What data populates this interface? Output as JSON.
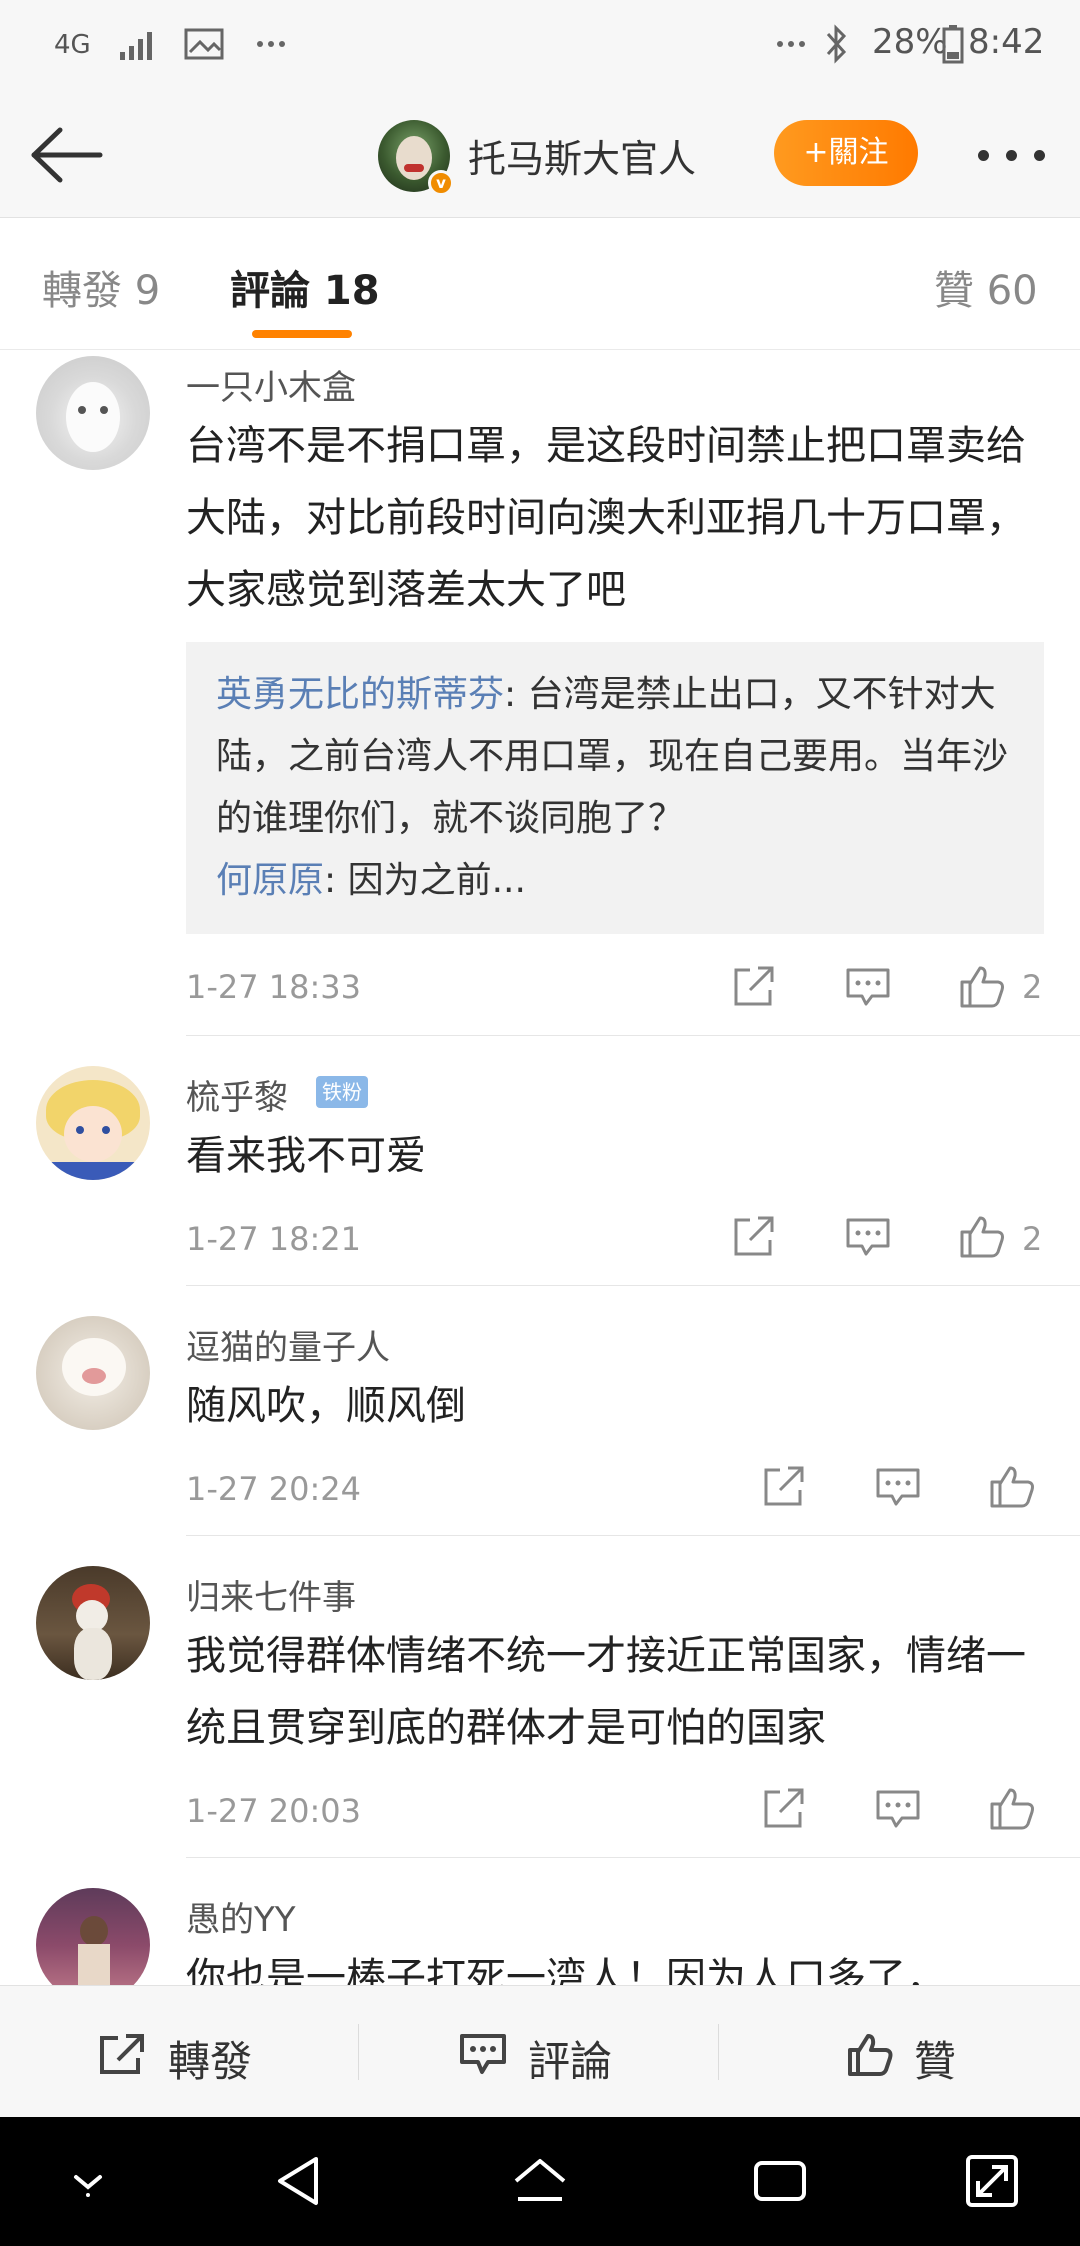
{
  "status_bar": {
    "network": "4G",
    "battery": "28%",
    "time": "8:42",
    "icons": [
      "signal-icon",
      "image-icon",
      "more-icon",
      "bluetooth-icon",
      "battery-icon"
    ]
  },
  "header": {
    "username": "托马斯大官人",
    "follow_label": "+關注"
  },
  "tabs": {
    "reposts": "轉發 9",
    "comments": "評論 18",
    "likes": "贊 60"
  },
  "comments": [
    {
      "name": "一只小木盒",
      "text": "台湾不是不捐口罩，是这段时间禁止把口罩卖给大陆，对比前段时间向澳大利亚捐几十万口罩，大家感觉到落差太大了吧",
      "replies": [
        {
          "user": "英勇无比的斯蒂芬",
          "sep": ": ",
          "text": "台湾是禁止出口，又不针对大陆，之前台湾人不用口罩，现在自己要用。当年沙的谁理你们，就不谈同胞了？"
        },
        {
          "user": "何原原",
          "sep": ":  ",
          "text": "因为之前..."
        }
      ],
      "time": "1-27 18:33",
      "likes": "2"
    },
    {
      "name": "梳乎黎",
      "badge": "铁粉",
      "text": "看来我不可爱",
      "time": "1-27 18:21",
      "likes": "2"
    },
    {
      "name": "逗猫的量子人",
      "text": "随风吹，顺风倒",
      "time": "1-27 20:24",
      "likes": ""
    },
    {
      "name": "归来七件事",
      "text": "我觉得群体情绪不统一才接近正常国家，情绪一统且贯穿到底的群体才是可怕的国家",
      "time": "1-27 20:03",
      "likes": ""
    },
    {
      "name": "愚的YY",
      "text": "你也是一棒子打死一湾人！因为人口多了，"
    }
  ],
  "bottom_bar": {
    "repost": "轉發",
    "comment": "評論",
    "like": "贊"
  },
  "colors": {
    "accent": "#ff8200",
    "link": "#5a7fb5",
    "badge": "#8bb8e8"
  }
}
